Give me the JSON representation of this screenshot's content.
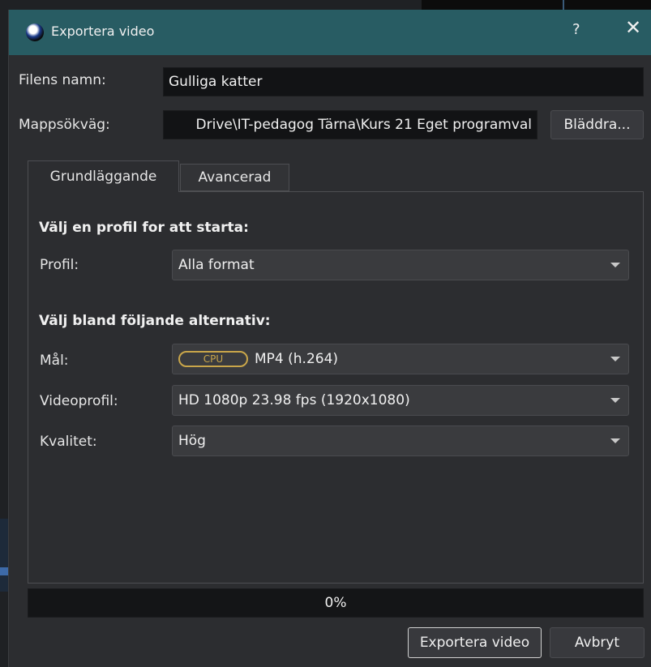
{
  "window": {
    "title": "Exportera video",
    "help_label": "?",
    "close_label": "✕"
  },
  "file": {
    "name_label": "Filens namn:",
    "name_value": "Gulliga katter",
    "folder_label": "Mappsökväg:",
    "folder_value": "Drive\\IT-pedagog Tärna\\Kurs 21 Eget programval",
    "browse_label": "Bläddra..."
  },
  "tabs": [
    {
      "label": "Grundläggande",
      "active": true
    },
    {
      "label": "Avancerad",
      "active": false
    }
  ],
  "profile_section": {
    "title": "Välj en profil for att starta:",
    "profile_label": "Profil:",
    "profile_value": "Alla format"
  },
  "options_section": {
    "title": "Välj bland följande alternativ:",
    "target_label": "Mål:",
    "target_badge": "CPU",
    "target_value": "MP4 (h.264)",
    "video_profile_label": "Videoprofil:",
    "video_profile_value": "HD 1080p 23.98 fps (1920x1080)",
    "quality_label": "Kvalitet:",
    "quality_value": "Hög"
  },
  "progress": {
    "value_percent": 0,
    "text": "0%"
  },
  "buttons": {
    "export_label": "Exportera video",
    "cancel_label": "Avbryt"
  },
  "colors": {
    "titlebar": "#285c63",
    "badge": "#c9a64a",
    "background": "#2c2d30"
  },
  "icons": {
    "app_logo": "openshot-logo-icon",
    "dropdown": "chevron-down-icon"
  }
}
